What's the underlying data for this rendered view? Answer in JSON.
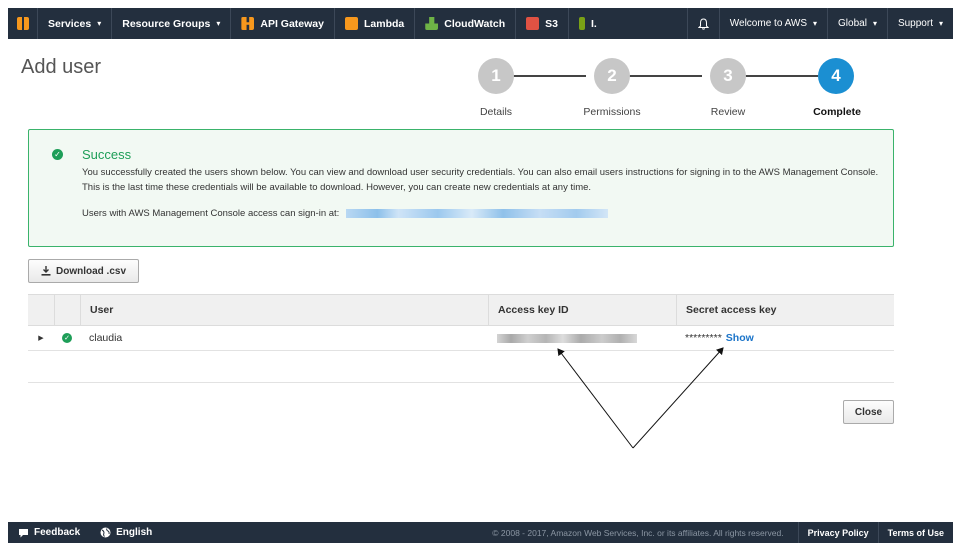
{
  "nav": {
    "items": [
      "Services",
      "Resource Groups"
    ],
    "services": [
      {
        "label": "API Gateway",
        "icon": "api-gateway-icon"
      },
      {
        "label": "Lambda",
        "icon": "lambda-icon"
      },
      {
        "label": "CloudWatch",
        "icon": "cloudwatch-icon"
      },
      {
        "label": "S3",
        "icon": "s3-icon"
      },
      {
        "label": "I.",
        "icon": "iam-icon"
      }
    ],
    "welcome": "Welcome to AWS",
    "region": "Global",
    "support": "Support",
    "chevron": "▾",
    "bell": "🔔"
  },
  "page": {
    "title": "Add user"
  },
  "steps": [
    {
      "number": "1",
      "label": "Details"
    },
    {
      "number": "2",
      "label": "Permissions"
    },
    {
      "number": "3",
      "label": "Review"
    },
    {
      "number": "4",
      "label": "Complete",
      "active": true
    }
  ],
  "success": {
    "heading": "Success",
    "message": "You successfully created the users shown below. You can view and download user security credentials. You can also email users instructions for signing in to the AWS Management Console. This is the last time these credentials will be available to download. However, you can create new credentials at any time.",
    "signin_text": "Users with AWS Management Console access can sign-in at:"
  },
  "download_button": "Download .csv",
  "table": {
    "columns": [
      "User",
      "Access key ID",
      "Secret access key"
    ],
    "rows": [
      {
        "user": "claudia",
        "secret_masked": "*********",
        "show_label": "Show"
      }
    ]
  },
  "close_button": "Close",
  "footer": {
    "feedback": "Feedback",
    "language": "English",
    "copyright": "© 2008 - 2017, Amazon Web Services, Inc. or its affiliates. All rights reserved.",
    "privacy": "Privacy Policy",
    "terms": "Terms of Use"
  },
  "colors": {
    "nav_bg": "#232f3e",
    "accent": "#1b8fd2",
    "success": "#1e9e58",
    "link": "#1b74c9"
  }
}
